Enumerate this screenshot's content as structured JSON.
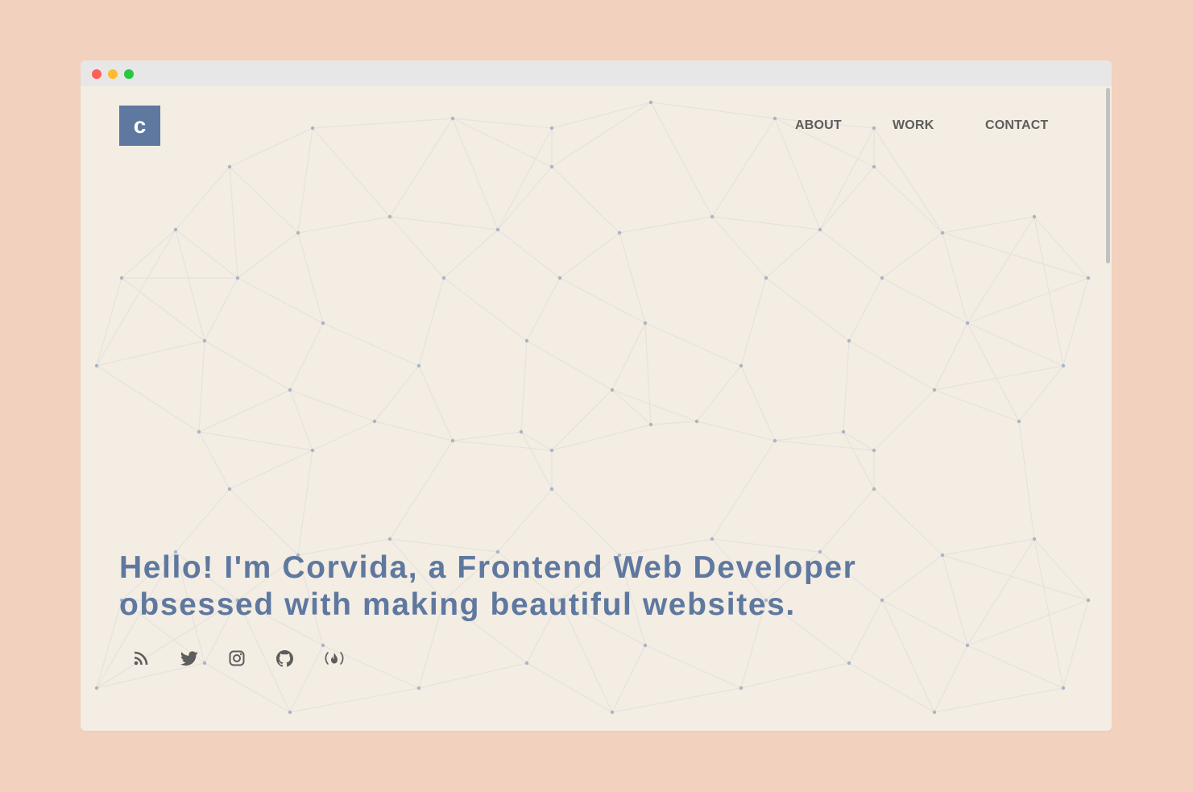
{
  "page": {
    "background_color": "#f2d2bf",
    "accent_color": "#5f78a0",
    "content_background": "#f3ede3"
  },
  "window": {
    "controls": [
      "close",
      "minimize",
      "maximize"
    ]
  },
  "header": {
    "logo_letter": "c",
    "nav": [
      {
        "label": "ABOUT"
      },
      {
        "label": "WORK"
      },
      {
        "label": "CONTACT"
      }
    ]
  },
  "hero": {
    "line1": "Hello! I'm Corvida, a Frontend Web Developer",
    "line2": "obsessed with making beautiful websites."
  },
  "socials": [
    {
      "icon": "rss-icon"
    },
    {
      "icon": "twitter-icon"
    },
    {
      "icon": "instagram-icon"
    },
    {
      "icon": "github-icon"
    },
    {
      "icon": "freecodecamp-icon"
    }
  ]
}
